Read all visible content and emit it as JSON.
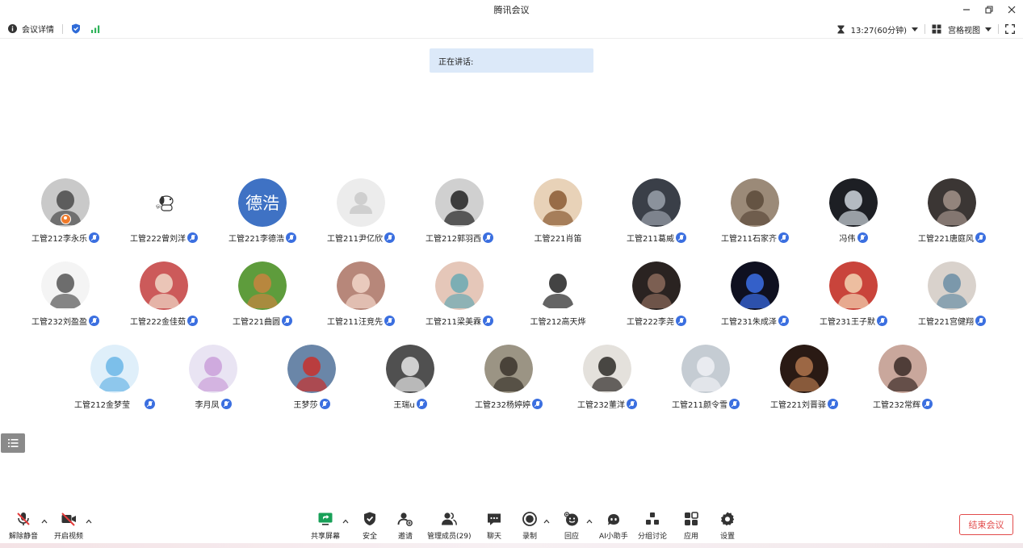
{
  "window": {
    "title": "腾讯会议"
  },
  "infobar": {
    "meeting_details": "会议详情",
    "timer": "13:27(60分钟)",
    "view_mode": "宫格视图"
  },
  "speaking_banner": "正在讲话:",
  "participants": [
    {
      "name": "工管212李永乐",
      "avatar": "photo-gray-boy",
      "host": true
    },
    {
      "name": "工管222曾刘洋",
      "avatar": "snoopy"
    },
    {
      "name": "工管221李德浩",
      "avatar": "text",
      "avatar_text": "德浩",
      "avatar_color": "#3f72c4"
    },
    {
      "name": "工管211尹亿欣",
      "avatar": "default"
    },
    {
      "name": "工管212郭羽西",
      "avatar": "photo-bw-boy"
    },
    {
      "name": "工管221肖笛",
      "avatar": "cat",
      "mic": false
    },
    {
      "name": "工管211葛威",
      "avatar": "photo-night"
    },
    {
      "name": "工管211石家齐",
      "avatar": "photo-cats"
    },
    {
      "name": "冯伟",
      "avatar": "photo-dark-cat"
    },
    {
      "name": "工管221唐庭风",
      "avatar": "photo-cap"
    },
    {
      "name": "工管232刘盈盈",
      "avatar": "sketch-girl"
    },
    {
      "name": "工管222金佳茹",
      "avatar": "photo-girl-flower"
    },
    {
      "name": "工管221曲圆",
      "avatar": "chia-pet"
    },
    {
      "name": "工管211汪竞先",
      "avatar": "photo-girl"
    },
    {
      "name": "工管211梁美霖",
      "avatar": "anime-boy"
    },
    {
      "name": "工管212高天烨",
      "avatar": "sketch-boy",
      "mic": false
    },
    {
      "name": "工管222李尧",
      "avatar": "photo-dark-room"
    },
    {
      "name": "工管231朱成泽",
      "avatar": "photo-blue-art"
    },
    {
      "name": "工管231王子默",
      "avatar": "art-face"
    },
    {
      "name": "工管221宫健翔",
      "avatar": "photo-plush"
    },
    {
      "name": "工管212金梦莹",
      "avatar": "stitch",
      "gap": true
    },
    {
      "name": "李月凤",
      "avatar": "anime-girls"
    },
    {
      "name": "王梦莎",
      "avatar": "photo-flag"
    },
    {
      "name": "王瑞u",
      "avatar": "photo-bw-cat"
    },
    {
      "name": "工管232杨婷婷",
      "avatar": "photo-silhouette"
    },
    {
      "name": "工管232董洋",
      "avatar": "photo-man-glasses"
    },
    {
      "name": "工管211颜令雪",
      "avatar": "photo-girl-dress"
    },
    {
      "name": "工管221刘晋驿",
      "avatar": "photo-dark-warm"
    },
    {
      "name": "工管232常辉",
      "avatar": "photo-girl-flowers"
    }
  ],
  "toolbar": {
    "unmute": "解除静音",
    "start_video": "开启视频",
    "share_screen": "共享屏幕",
    "security": "安全",
    "invite": "邀请",
    "manage_members": "管理成员(29)",
    "chat": "聊天",
    "record": "录制",
    "react": "回应",
    "ai_assistant": "AI小助手",
    "breakout": "分组讨论",
    "apps": "应用",
    "settings": "设置",
    "end_meeting": "结束会议"
  }
}
